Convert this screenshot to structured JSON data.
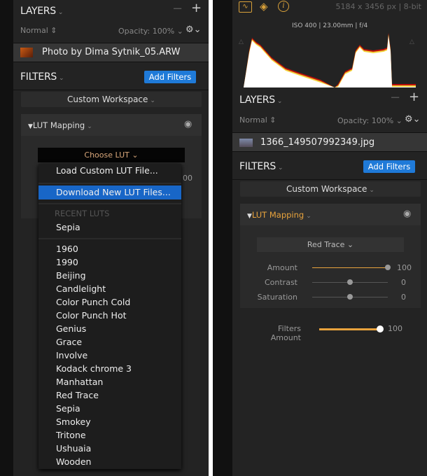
{
  "left": {
    "layers": {
      "title": "LAYERS",
      "minus": "−",
      "plus": "+",
      "blend_mode": "Normal",
      "opacity": "Opacity: 100%",
      "layer_name": "Photo by Dima Sytnik_05.ARW"
    },
    "filters": {
      "title": "FILTERS",
      "add_button": "Add Filters",
      "workspace": "Custom Workspace"
    },
    "lut": {
      "title": "LUT Mapping",
      "choose": "Choose LUT",
      "obscured_value": "00"
    },
    "menu": {
      "load": "Load Custom LUT File...",
      "download": "Download New LUT Files...",
      "recent_header": "RECENT LUTS",
      "recent": [
        "Sepia"
      ],
      "items": [
        "1960",
        "1990",
        "Beijing",
        "Candlelight",
        "Color Punch Cold",
        "Color Punch Hot",
        "Genius",
        "Grace",
        "Involve",
        "Kodack chrome  3",
        "Manhattan",
        "Red Trace",
        "Sepia",
        "Smokey",
        "Tritone",
        "Ushuaia",
        "Wooden"
      ]
    }
  },
  "right": {
    "toolbar": {
      "icons": [
        "histogram-icon",
        "layers-icon",
        "info-icon"
      ],
      "image_info": "5184 x 3456 px  |  8-bit"
    },
    "histogram": {
      "exif": "ISO 400  |  23.00mm  |  f/4"
    },
    "layers": {
      "title": "LAYERS",
      "minus": "−",
      "plus": "+",
      "blend_mode": "Normal",
      "opacity": "Opacity: 100%",
      "layer_name": "1366_149507992349.jpg"
    },
    "filters": {
      "title": "FILTERS",
      "add_button": "Add Filters",
      "workspace": "Custom Workspace"
    },
    "lut": {
      "title": "LUT Mapping",
      "selected": "Red Trace",
      "sliders": [
        {
          "label": "Amount",
          "value": "100",
          "level": 1.0
        },
        {
          "label": "Contrast",
          "value": "0",
          "level": 0.5
        },
        {
          "label": "Saturation",
          "value": "0",
          "level": 0.5
        }
      ]
    },
    "filters_amount": {
      "label": "Filters Amount",
      "value": "100",
      "level": 1.0
    }
  },
  "colors": {
    "accent": "#1f7ad8",
    "lut_title": "#e8a33d",
    "slider_fill": "#e8a33d"
  }
}
